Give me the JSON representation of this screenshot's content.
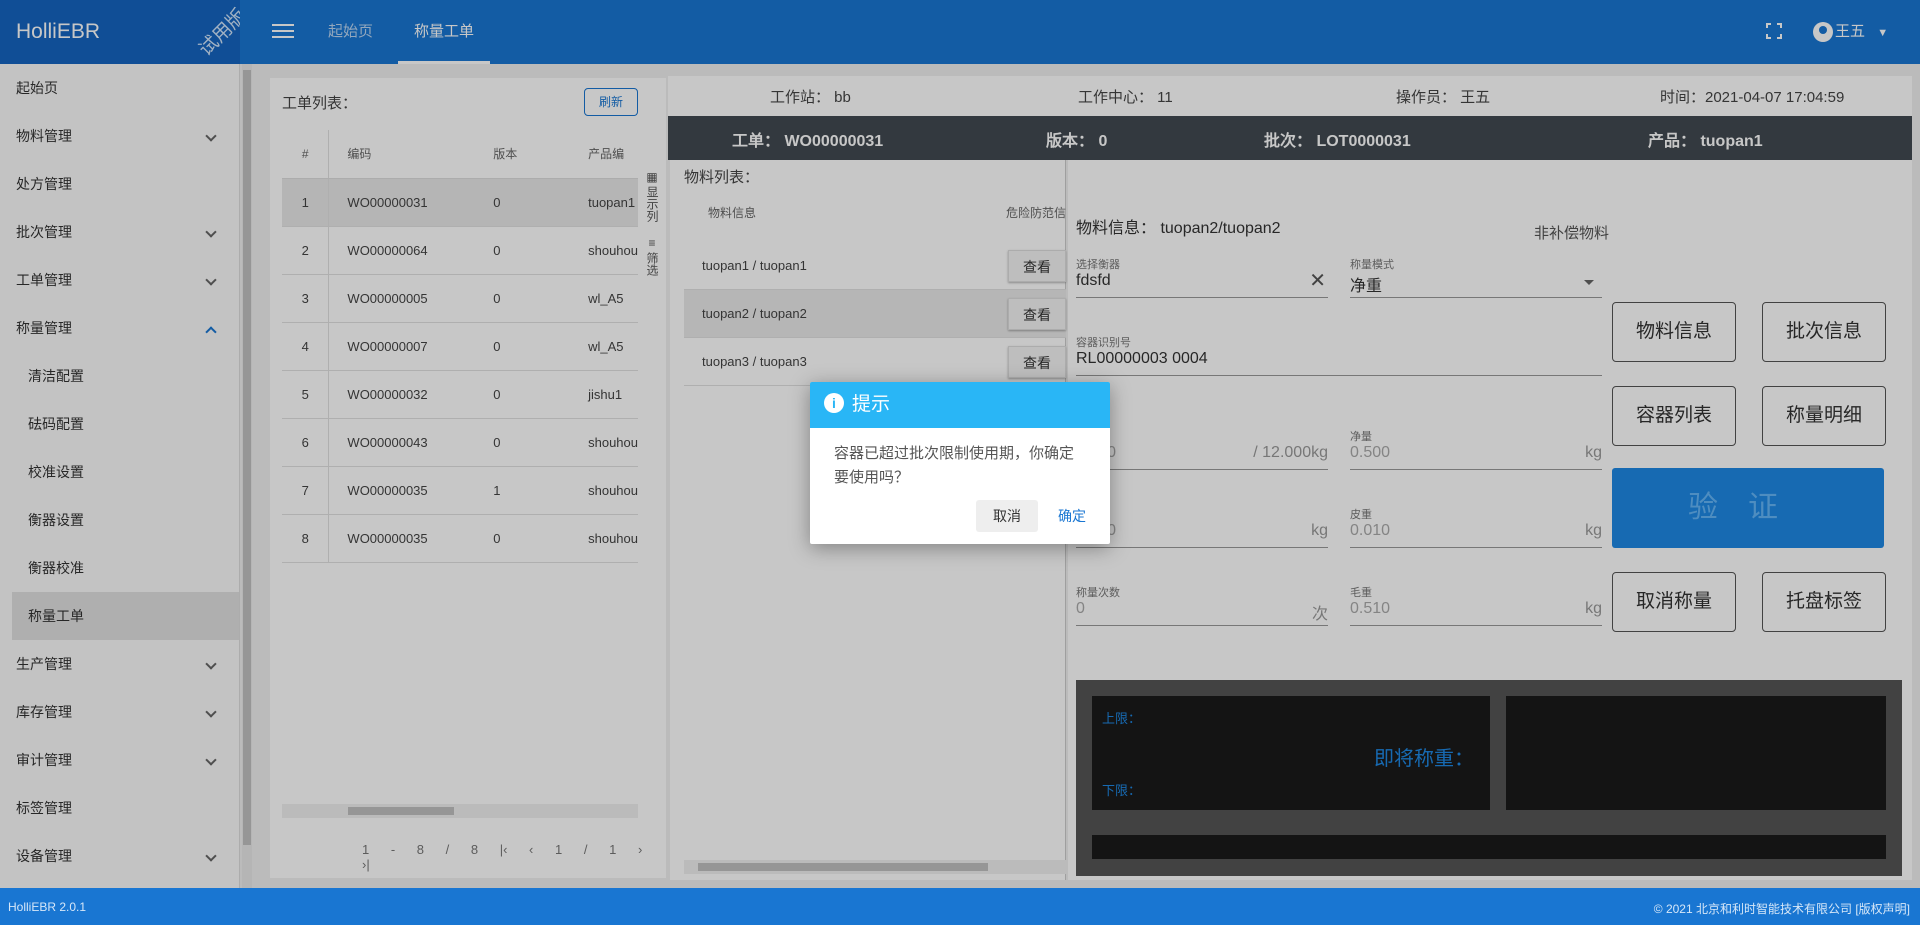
{
  "app": {
    "name": "HolliEBR",
    "ribbon": "试用版"
  },
  "header": {
    "tabs": [
      {
        "label": "起始页",
        "active": false
      },
      {
        "label": "称量工单",
        "active": true
      }
    ],
    "user": "王五"
  },
  "sidebar": {
    "items": [
      {
        "label": "起始页"
      },
      {
        "label": "物料管理"
      },
      {
        "label": "处方管理"
      },
      {
        "label": "批次管理"
      },
      {
        "label": "工单管理"
      },
      {
        "label": "称量管理"
      },
      {
        "label": "清洁配置"
      },
      {
        "label": "砝码配置"
      },
      {
        "label": "校准设置"
      },
      {
        "label": "衡器设置"
      },
      {
        "label": "衡器校准"
      },
      {
        "label": "称量工单"
      },
      {
        "label": "生产管理"
      },
      {
        "label": "库存管理"
      },
      {
        "label": "审计管理"
      },
      {
        "label": "标签管理"
      },
      {
        "label": "设备管理"
      }
    ]
  },
  "wo_list": {
    "title": "工单列表：",
    "refresh": "刷新",
    "columns": [
      "#",
      "编码",
      "版本",
      "产品编"
    ],
    "rows": [
      {
        "n": "1",
        "code": "WO00000031",
        "ver": "0",
        "prod": "tuopan1"
      },
      {
        "n": "2",
        "code": "WO00000064",
        "ver": "0",
        "prod": "shouhou"
      },
      {
        "n": "3",
        "code": "WO00000005",
        "ver": "0",
        "prod": "wl_A5"
      },
      {
        "n": "4",
        "code": "WO00000007",
        "ver": "0",
        "prod": "wl_A5"
      },
      {
        "n": "5",
        "code": "WO00000032",
        "ver": "0",
        "prod": "jishu1"
      },
      {
        "n": "6",
        "code": "WO00000043",
        "ver": "0",
        "prod": "shouhou"
      },
      {
        "n": "7",
        "code": "WO00000035",
        "ver": "1",
        "prod": "shouhou"
      },
      {
        "n": "8",
        "code": "WO00000035",
        "ver": "0",
        "prod": "shouhou"
      }
    ],
    "range": "1 - 8 / 8",
    "page": "1 / 1",
    "side_tab_1": "显示列",
    "side_tab_2": "筛选"
  },
  "info": {
    "station": "工作站： bb",
    "center": "工作中心： 11",
    "operator": "操作员： 王五",
    "time": "时间：2021-04-07 17:04:59"
  },
  "order": {
    "wo": "工单： WO00000031",
    "ver": "版本： 0",
    "lot": "批次： LOT0000031",
    "product": "产品： tuopan1"
  },
  "materials": {
    "title": "物料列表：",
    "col1": "物料信息",
    "col2": "危险防范信",
    "rows": [
      "tuopan1 / tuopan1",
      "tuopan2 / tuopan2",
      "tuopan3 / tuopan3"
    ],
    "view": "查看"
  },
  "detail": {
    "mat_info": "物料信息： tuopan2/tuopan2",
    "non_supp": "非补偿物料",
    "scale_label": "选择衡器",
    "scale_val": "fdsfd",
    "mode_label": "称量模式",
    "mode_val": "净重",
    "container_label": "容器识别号",
    "container_val": "RL00000003 0004",
    "cur_val": "0.000",
    "limit_val": "/ 12.000kg",
    "net_label": "净量",
    "net_val": "0.500",
    "tare_left_val": "0.010",
    "tare_label": "皮重",
    "tare_val": "0.010",
    "count_label": "称量次数",
    "count_val": "0",
    "count_unit": "次",
    "gross_label": "毛重",
    "gross_val": "0.510",
    "unit_kg": "kg",
    "btn_material": "物料信息",
    "btn_lot": "批次信息",
    "btn_container": "容器列表",
    "btn_detail": "称量明细",
    "btn_verify": "验证",
    "btn_cancel": "取消称量",
    "btn_pallet": "托盘标签",
    "upper": "上限：",
    "lower": "下限：",
    "soon": "即将称重："
  },
  "dialog": {
    "title": "提示",
    "message": "容器已超过批次限制使用期，你确定要使用吗？",
    "cancel": "取消",
    "ok": "确定"
  },
  "footer": {
    "version": "HolliEBR 2.0.1",
    "copyright": "© 2021  北京和利时智能技术有限公司 [版权声明]"
  }
}
